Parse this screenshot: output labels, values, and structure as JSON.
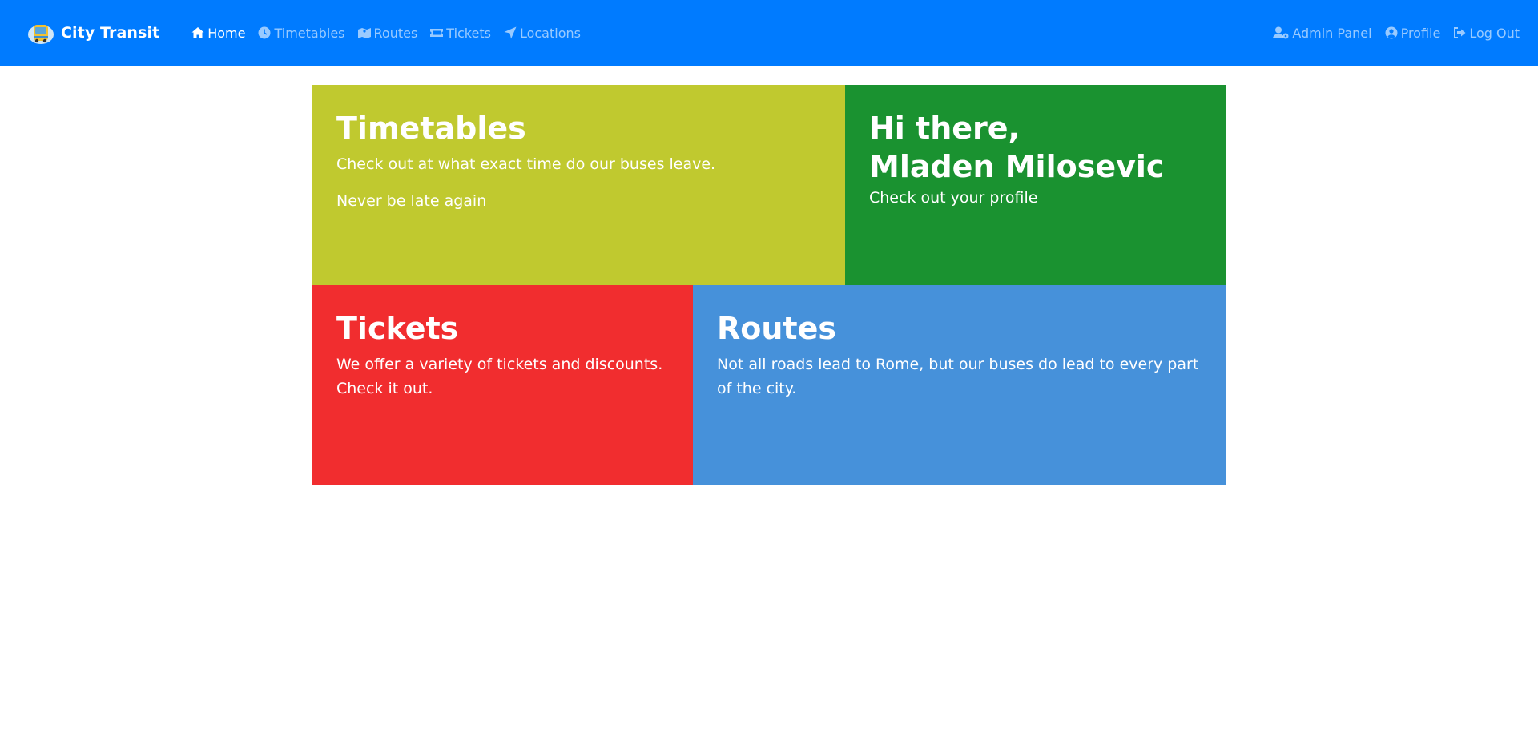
{
  "nav": {
    "brand": "City Transit",
    "left": [
      {
        "label": "Home",
        "icon": "home-icon",
        "active": true
      },
      {
        "label": "Timetables",
        "icon": "clock-icon"
      },
      {
        "label": "Routes",
        "icon": "map-icon"
      },
      {
        "label": "Tickets",
        "icon": "ticket-icon"
      },
      {
        "label": "Locations",
        "icon": "location-arrow-icon"
      }
    ],
    "right": [
      {
        "label": "Admin Panel",
        "icon": "user-cog-icon"
      },
      {
        "label": "Profile",
        "icon": "user-circle-icon"
      },
      {
        "label": "Log Out",
        "icon": "sign-out-icon"
      }
    ]
  },
  "tiles": {
    "timetables": {
      "title": "Timetables",
      "line1": "Check out at what exact time do our buses leave.",
      "line2": "Never be late again",
      "color": "#c0c92f"
    },
    "greeting": {
      "title_line1": "Hi there,",
      "title_line2": "Mladen Milosevic",
      "text": "Check out your profile",
      "color": "#1a9230"
    },
    "tickets": {
      "title": "Tickets",
      "text": "We offer a variety of tickets and discounts. Check it out.",
      "color": "#f12d2f"
    },
    "routes": {
      "title": "Routes",
      "text": "Not all roads lead to Rome, but our buses do lead to every part of the city.",
      "color": "#4691da"
    }
  },
  "colors": {
    "navbar": "#007bff"
  }
}
